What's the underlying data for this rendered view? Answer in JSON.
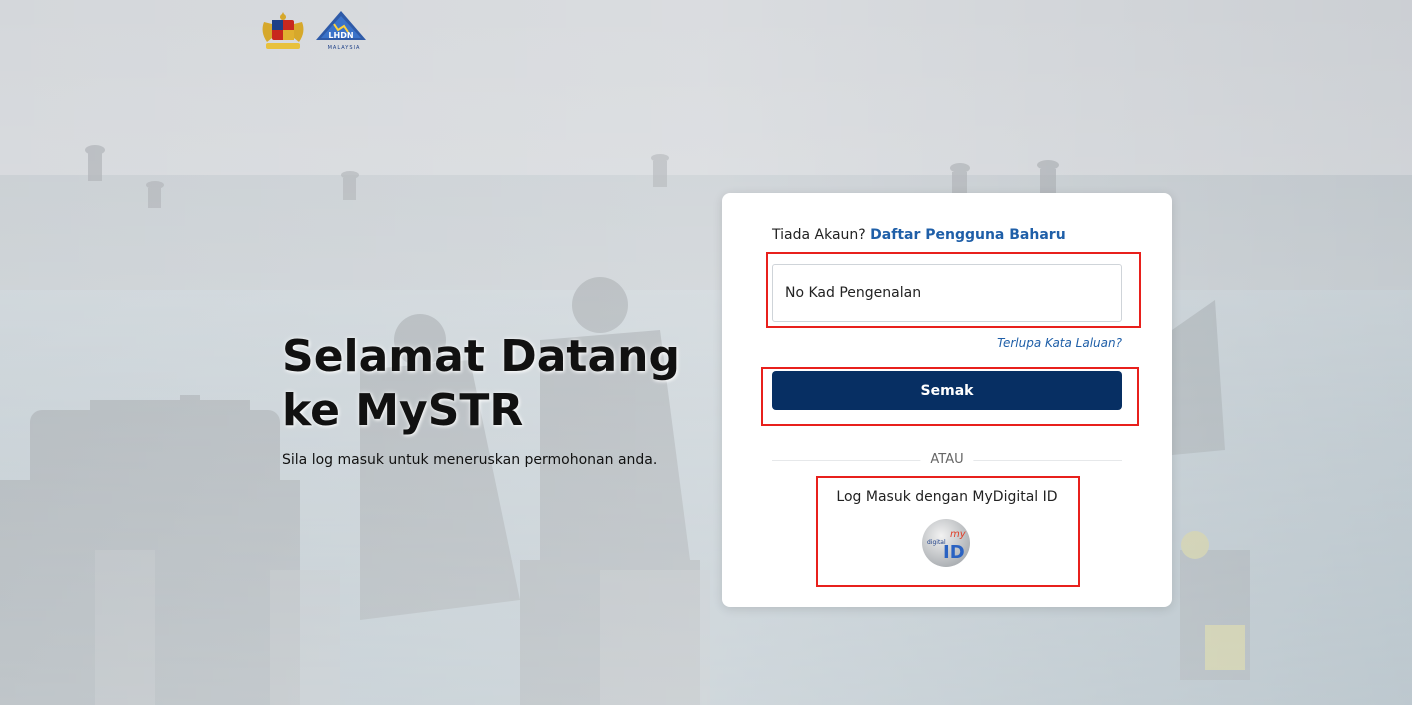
{
  "colors": {
    "primary_button": "#072f63",
    "link": "#1f5fa8",
    "highlight": "#e8201c",
    "card_bg": "#ffffff"
  },
  "header": {
    "logos": [
      "malaysia-crest-icon",
      "lhdn-logo-icon"
    ],
    "lhdn_text": "LHDN",
    "lhdn_subtext": "MALAYSIA"
  },
  "hero": {
    "title_line1": "Selamat Datang",
    "title_line2": "ke MySTR",
    "subtitle": "Sila log masuk untuk meneruskan permohonan anda."
  },
  "login": {
    "no_account_text": "Tiada Akaun?",
    "register_link": "Daftar Pengguna Baharu",
    "ic_placeholder": "No Kad Pengenalan",
    "forgot_password": "Terlupa Kata Laluan?",
    "check_button": "Semak",
    "divider_text": "ATAU",
    "mydigital_label": "Log Masuk dengan MyDigital ID",
    "mydigital_logo_text_my": "my",
    "mydigital_logo_text_digital": "digital",
    "mydigital_logo_text_id": "ID"
  }
}
